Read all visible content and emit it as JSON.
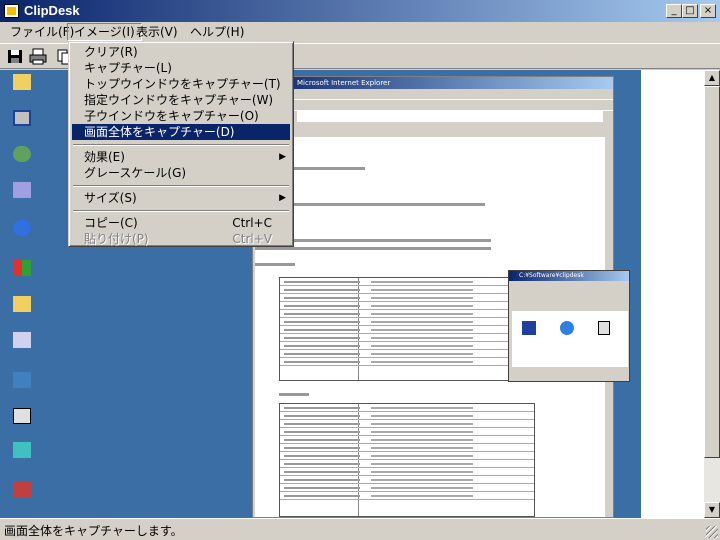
{
  "window": {
    "title": "ClipDesk",
    "minimize_glyph": "_",
    "maximize_glyph": "□",
    "close_glyph": "×"
  },
  "menubar": {
    "items": [
      {
        "label": "ファイル(F)"
      },
      {
        "label": "イメージ(I)"
      },
      {
        "label": "表示(V)"
      },
      {
        "label": "ヘルプ(H)"
      }
    ]
  },
  "toolbar": {
    "icons": [
      "save-icon",
      "print-icon",
      "copy-icon"
    ]
  },
  "image_menu": {
    "items": [
      {
        "label": "クリア(R)",
        "shortcut": ""
      },
      {
        "label": "キャプチャー(L)",
        "shortcut": ""
      },
      {
        "label": "トップウインドウをキャプチャー(T)",
        "shortcut": ""
      },
      {
        "label": "指定ウインドウをキャプチャー(W)",
        "shortcut": ""
      },
      {
        "label": "子ウインドウをキャプチャー(O)",
        "shortcut": ""
      },
      {
        "label": "画面全体をキャプチャー(D)",
        "shortcut": "",
        "highlighted": true
      },
      {
        "label": "効果(E)",
        "submenu": true
      },
      {
        "label": "グレースケール(G)",
        "shortcut": ""
      },
      {
        "label": "サイズ(S)",
        "submenu": true
      },
      {
        "label": "コピー(C)",
        "shortcut": "Ctrl+C"
      },
      {
        "label": "貼り付け(P)",
        "shortcut": "Ctrl+V",
        "disabled": true
      }
    ],
    "submenu_glyph": "▶"
  },
  "captured_screen": {
    "ie_title": "Microsoft Internet Explorer",
    "page_heading": "esk",
    "explorer_title": "C:¥Software¥clipdesk"
  },
  "statusbar": {
    "text": "画面全体をキャプチャーします。"
  },
  "scrollbar": {
    "up_glyph": "▲",
    "down_glyph": "▼"
  },
  "colors": {
    "titlebar_start": "#0a246a",
    "titlebar_end": "#a6caf0",
    "desktop": "#3a6ea5",
    "menu_highlight": "#0a246a"
  }
}
